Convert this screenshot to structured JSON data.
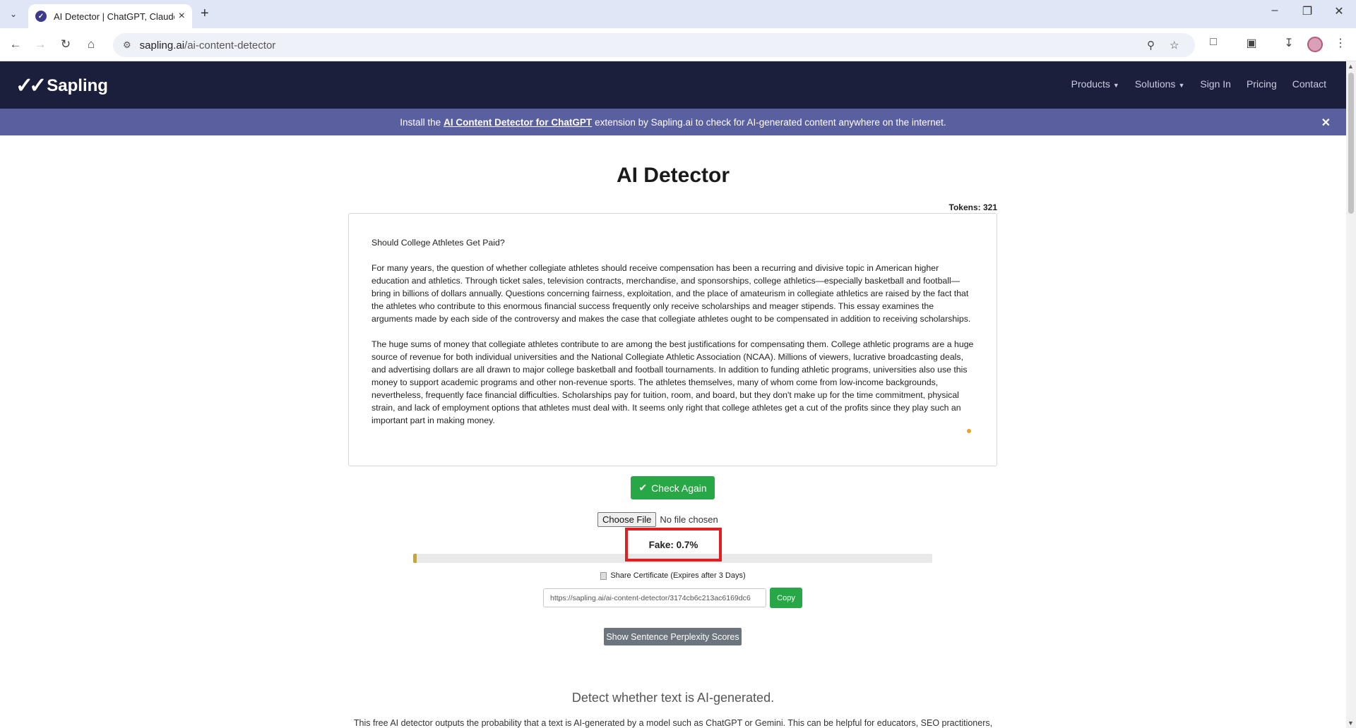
{
  "browser": {
    "tab_title": "AI Detector | ChatGPT, Claude",
    "url_host": "sapling.ai",
    "url_path": "/ai-content-detector"
  },
  "site": {
    "logo": "Sapling",
    "menu": {
      "products": "Products",
      "solutions": "Solutions",
      "sign_in": "Sign In",
      "pricing": "Pricing",
      "contact": "Contact"
    }
  },
  "banner": {
    "prefix": "Install the",
    "link": "AI Content Detector for ChatGPT",
    "suffix": "extension by Sapling.ai to check for AI-generated content anywhere on the internet."
  },
  "main": {
    "title": "AI Detector",
    "tokens": "Tokens: 321",
    "essay": {
      "heading": "Should College Athletes Get Paid?",
      "p1": "For many years, the question of whether collegiate athletes should receive compensation has been a recurring and divisive topic in American higher education and athletics.  Through ticket sales, television contracts, merchandise, and sponsorships, college athletics—especially basketball and football—bring in billions of dollars annually.  Questions concerning fairness, exploitation, and the place of amateurism in collegiate athletics are raised by the fact that the athletes who contribute to this enormous financial success frequently only receive scholarships and meager stipends.  This essay examines the arguments made by each side of the controversy and makes the case that collegiate athletes ought to be compensated in addition to receiving scholarships.",
      "p2": "The huge sums of money that collegiate athletes contribute to are among the best justifications for compensating them.  College athletic programs are a huge source of revenue for both individual universities and the National Collegiate Athletic Association (NCAA).  Millions of viewers, lucrative broadcasting deals, and advertising dollars are all drawn to major college basketball and football tournaments.  In addition to funding athletic programs, universities also use this money to support academic programs and other non-revenue sports.  The athletes themselves, many of whom come from low-income backgrounds, nevertheless, frequently face financial difficulties.  Scholarships pay for tuition, room, and board, but they don't make up for the time commitment, physical strain, and lack of employment options that athletes must deal with.  It seems only right that college athletes get a cut of the profits since they play such an important part in making money."
    },
    "check_button": "Check Again",
    "choose_file": "Choose File",
    "file_status": "No file chosen",
    "result": "Fake: 0.7%",
    "fake_fraction": 0.007,
    "share_label": "Share Certificate (Expires after 3 Days)",
    "certificate_url": "https://sapling.ai/ai-content-detector/3174cb6c213ac6169dc6",
    "copy_button": "Copy",
    "perplexity_button": "Show Sentence Perplexity Scores",
    "subheading": "Detect whether text is AI-generated.",
    "description": "This free AI detector outputs the probability that a text is AI-generated by a model such as ChatGPT or Gemini. This can be helpful for educators, SEO practitioners,"
  },
  "colors": {
    "nav_bg": "#1b1f3b",
    "banner_bg": "#5a5fa0",
    "accent_green": "#27a745",
    "highlight_red": "#e02020",
    "progress_fill": "#c9a830"
  }
}
